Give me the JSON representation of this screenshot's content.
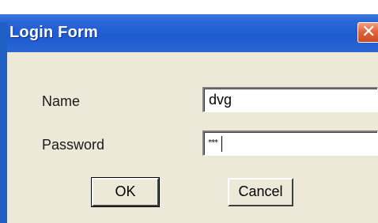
{
  "window": {
    "title": "Login Form",
    "close_glyph": "✕"
  },
  "form": {
    "name_label": "Name",
    "name_value": "dvg",
    "password_label": "Password",
    "password_masked": "***"
  },
  "buttons": {
    "ok_label": "OK",
    "cancel_label": "Cancel"
  },
  "icons": {
    "close": "close-icon"
  },
  "colors": {
    "titlebar": "#2a68d8",
    "close_button": "#e2643d",
    "dialog_background": "#ece9d8"
  }
}
